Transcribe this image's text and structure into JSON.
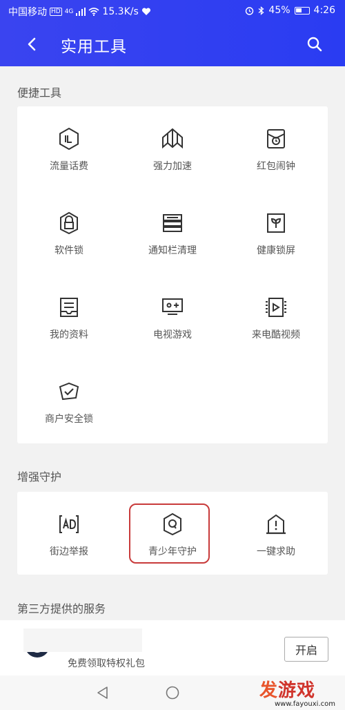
{
  "status_bar": {
    "carrier": "中国移动",
    "hd_badge": "HD",
    "network": "4G",
    "speed": "15.3K/s",
    "battery": "45%",
    "time": "4:26"
  },
  "header": {
    "title": "实用工具"
  },
  "sections": {
    "quick_tools": {
      "title": "便捷工具",
      "items": [
        {
          "label": "流量话费",
          "icon": "data-usage-icon"
        },
        {
          "label": "强力加速",
          "icon": "boost-icon"
        },
        {
          "label": "红包闹钟",
          "icon": "red-packet-alarm-icon"
        },
        {
          "label": "软件锁",
          "icon": "app-lock-icon"
        },
        {
          "label": "通知栏清理",
          "icon": "notification-clean-icon"
        },
        {
          "label": "健康锁屏",
          "icon": "healthy-lockscreen-icon"
        },
        {
          "label": "我的资料",
          "icon": "my-profile-icon"
        },
        {
          "label": "电视游戏",
          "icon": "tv-game-icon"
        },
        {
          "label": "来电酷视频",
          "icon": "call-video-icon"
        },
        {
          "label": "商户安全锁",
          "icon": "merchant-lock-icon"
        }
      ]
    },
    "enhanced": {
      "title": "增强守护",
      "items": [
        {
          "label": "街边举报",
          "icon": "ad-report-icon"
        },
        {
          "label": "青少年守护",
          "icon": "youth-guard-icon"
        },
        {
          "label": "一键求助",
          "icon": "sos-icon"
        }
      ]
    },
    "third_party": {
      "title": "第三方提供的服务",
      "service": {
        "description": "免费领取特权礼包",
        "button": "开启"
      }
    }
  },
  "watermark": {
    "text_a": "发",
    "text_b": "游戏",
    "url": "www.fayouxi.com"
  },
  "colors": {
    "header": "#2f3ff0",
    "highlight": "#c83a3a"
  }
}
